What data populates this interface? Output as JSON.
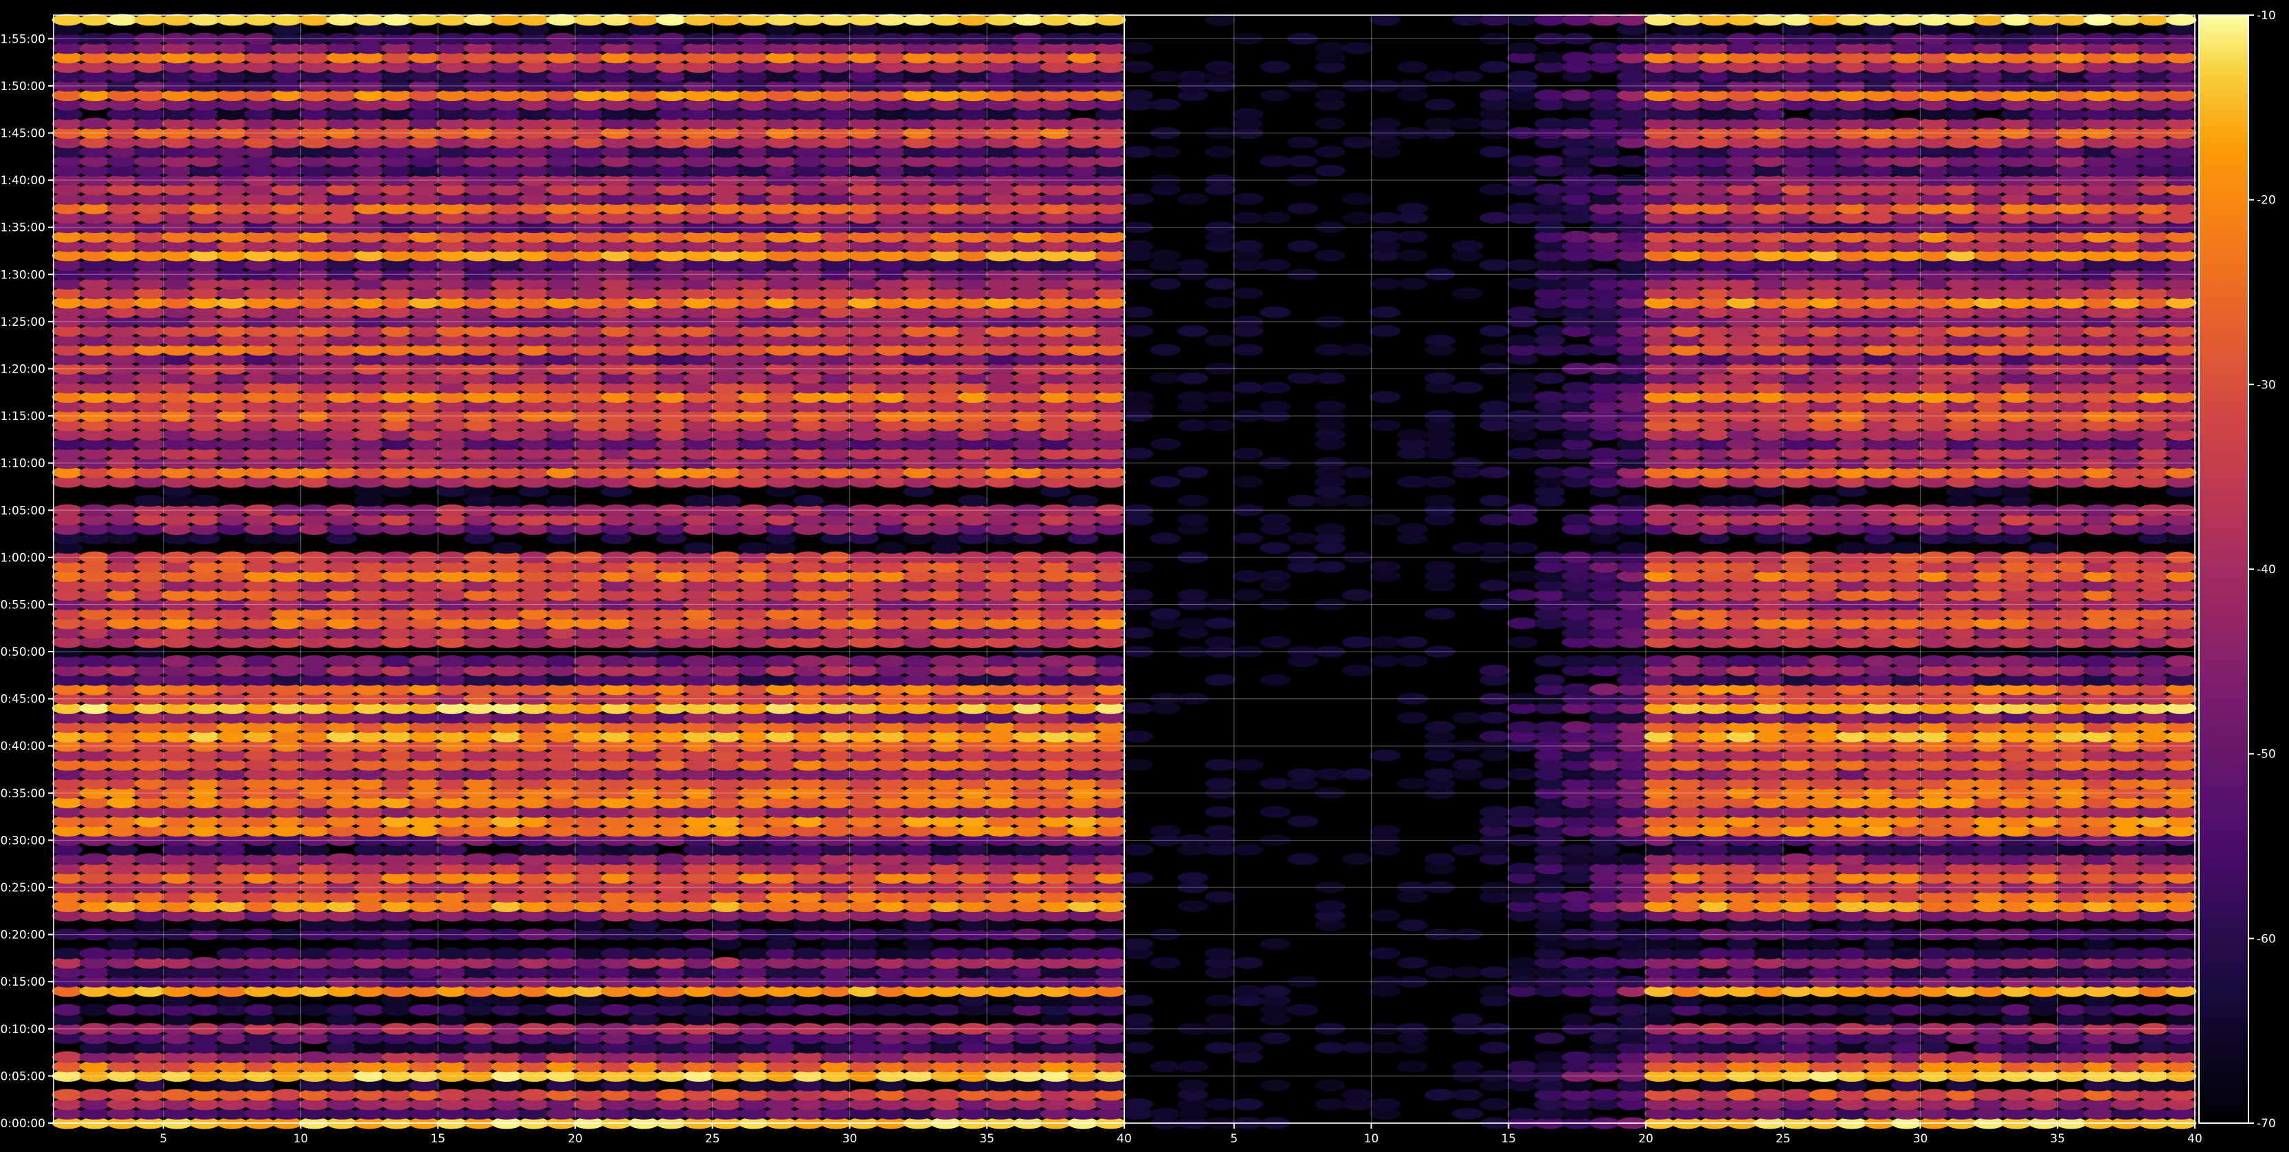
{
  "chart_data": {
    "type": "heatmap",
    "title": "",
    "xlabel": "",
    "ylabel": "",
    "panels": [
      {
        "name": "",
        "xlim": [
          1,
          40
        ],
        "active_from": 1,
        "hot_from": 1
      },
      {
        "name": "",
        "xlim": [
          1,
          40
        ],
        "active_from": 14,
        "hot_from": 20
      }
    ],
    "xticks": [
      5,
      10,
      15,
      20,
      25,
      30,
      35,
      40
    ],
    "yticks": [
      "0:00:00",
      "0:05:00",
      "0:10:00",
      "0:15:00",
      "0:20:00",
      "0:25:00",
      "0:30:00",
      "0:35:00",
      "0:40:00",
      "0:45:00",
      "0:50:00",
      "0:55:00",
      "1:00:00",
      "1:05:00",
      "1:10:00",
      "1:15:00",
      "1:20:00",
      "1:25:00",
      "1:30:00",
      "1:35:00",
      "1:40:00",
      "1:45:00",
      "1:50:00",
      "1:55:00"
    ],
    "ylim_minutes": [
      0,
      117.5
    ],
    "row_step_minutes": 1,
    "colorbar": {
      "colormap": "inferno",
      "min": -70,
      "max": -10,
      "ticks": [
        -70,
        -60,
        -50,
        -40,
        -30,
        -20,
        -10
      ]
    },
    "grid": true,
    "row_levels_db": [
      -18,
      -55,
      -46,
      -35,
      -66,
      -18,
      -30,
      -44,
      -62,
      -55,
      -44,
      -70,
      -60,
      -70,
      -24,
      -52,
      -60,
      -46,
      -62,
      -70,
      -58,
      -70,
      -48,
      -24,
      -32,
      -42,
      -30,
      -40,
      -48,
      -62,
      -54,
      -28,
      -26,
      -44,
      -28,
      -30,
      -32,
      -46,
      -32,
      -40,
      -32,
      -22,
      -30,
      -50,
      -18,
      -38,
      -30,
      -58,
      -46,
      -52,
      -70,
      -40,
      -44,
      -30,
      -34,
      -46,
      -34,
      -42,
      -30,
      -36,
      -38,
      -70,
      -66,
      -50,
      -42,
      -45,
      -70,
      -70,
      -42,
      -30,
      -46,
      -42,
      -52,
      -44,
      -38,
      -32,
      -40,
      -28,
      -40,
      -46,
      -40,
      -52,
      -32,
      -44,
      -36,
      -50,
      -42,
      -26,
      -40,
      -46,
      -52,
      -56,
      -24,
      -44,
      -30,
      -54,
      -42,
      -32,
      -48,
      -40,
      -48,
      -58,
      -50,
      -58,
      -40,
      -32,
      -46,
      -62,
      -50,
      -28,
      -56,
      -60,
      -44,
      -30,
      -50,
      -58,
      -70,
      -16
    ]
  }
}
